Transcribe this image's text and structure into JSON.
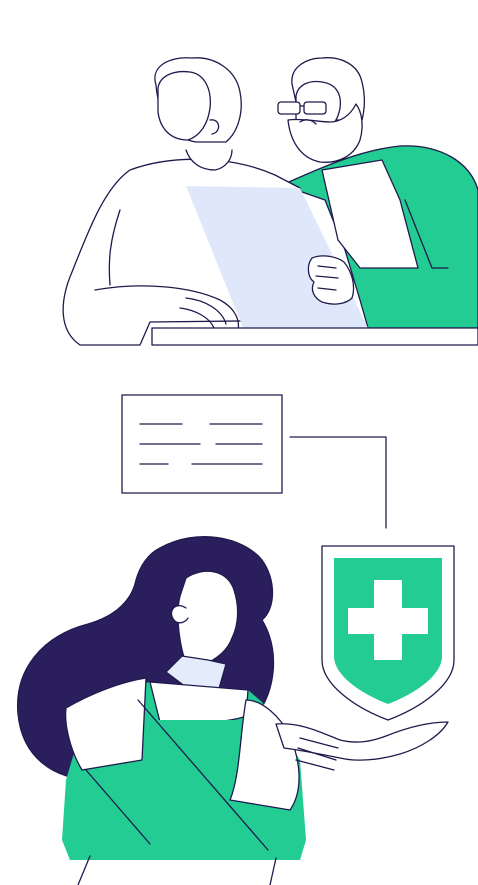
{
  "illustration": {
    "colors": {
      "background": "#ffffff",
      "accent_green": "#22cc92",
      "outline": "#1f1a4d",
      "hair_dark": "#2a1f5c",
      "document_blue": "#dfe8fb",
      "collar_blue": "#e4ecfb",
      "white": "#ffffff"
    },
    "scene_top": {
      "subjects": [
        "elderly-woman",
        "elderly-man-with-glasses-and-beard"
      ],
      "props": [
        "document-sheet",
        "table-edge"
      ]
    },
    "scene_bottom": {
      "subjects": [
        "woman-with-long-dark-hair"
      ],
      "props": [
        "text-card",
        "connector-line",
        "health-shield-plus-icon"
      ]
    }
  }
}
